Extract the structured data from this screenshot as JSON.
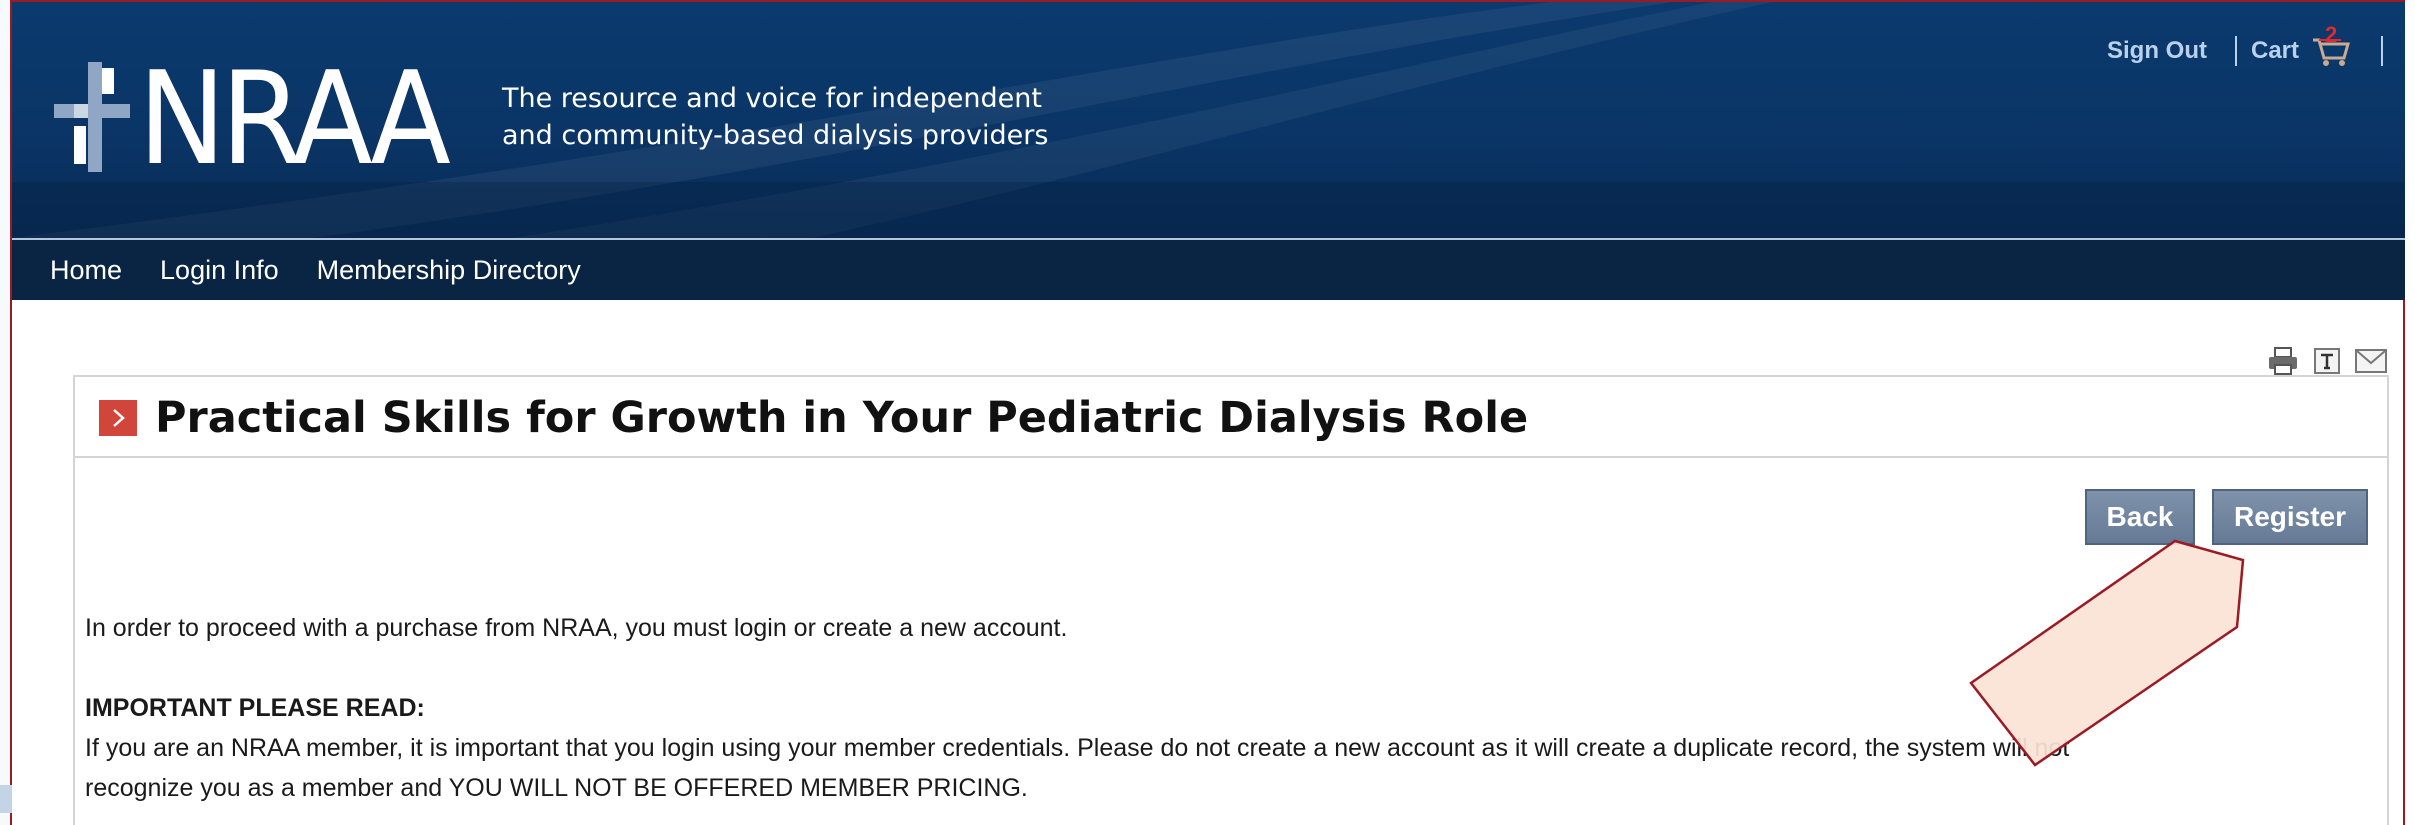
{
  "header": {
    "logo_text": "NRAA",
    "tagline_line1": "The resource and voice for independent",
    "tagline_line2": "and community-based dialysis providers",
    "sign_out_label": "Sign Out",
    "cart_label": "Cart",
    "cart_count": "2"
  },
  "nav": {
    "items": [
      {
        "label": "Home"
      },
      {
        "label": "Login Info"
      },
      {
        "label": "Membership Directory"
      }
    ]
  },
  "page_tools": {
    "icons": [
      "print-icon",
      "text-size-icon",
      "email-icon"
    ]
  },
  "main": {
    "title": "Practical Skills for Growth in Your Pediatric Dialysis Role",
    "back_label": "Back",
    "register_label": "Register",
    "intro": "In order to proceed with a purchase from NRAA, you must login or create a new account.",
    "important_heading": "IMPORTANT PLEASE READ:",
    "paragraph_line1": "If you are an NRAA member, it is important that you login using your member credentials. Please do not create a new account as it will create a duplicate record, the system will not",
    "paragraph_line2": "recognize you as a member and YOU WILL NOT BE OFFERED MEMBER PRICING."
  },
  "colors": {
    "header_blue": "#0b3a6e",
    "nav_navy": "#0a2444",
    "button_slate": "#7389a5",
    "title_marker_red": "#d2453b",
    "annotation_fill": "#fbe3d6",
    "annotation_stroke": "#9b1b24"
  }
}
